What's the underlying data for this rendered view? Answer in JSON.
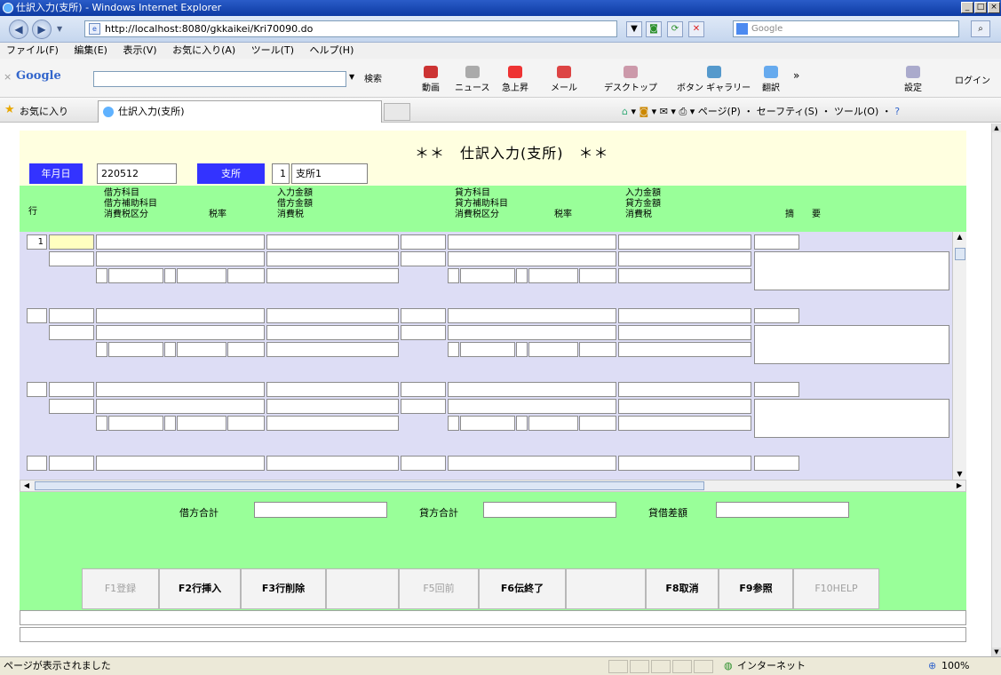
{
  "window": {
    "title": "仕訳入力(支所) - Windows Internet Explorer",
    "url": "http://localhost:8080/gkkaikei/Kri70090.do",
    "search_placeholder": "Google",
    "menu": [
      "ファイル(F)",
      "編集(E)",
      "表示(V)",
      "お気に入り(A)",
      "ツール(T)",
      "ヘルプ(H)"
    ],
    "google_label": "Google",
    "google_items": [
      "検索",
      "動画",
      "ニュース",
      "急上昇",
      "メール",
      "デスクトップ",
      "ボタン ギャラリー",
      "翻訳",
      "»",
      "設定",
      "ログイン"
    ],
    "favorites_label": "お気に入り",
    "tab_title": "仕訳入力(支所)",
    "command_bar": "ページ(P) ・ セーフティ(S) ・ ツール(O) ・",
    "status_text": "ページが表示されました",
    "zone": "インターネット",
    "zoom": "100%"
  },
  "form": {
    "title": "＊＊　仕訳入力(支所)　＊＊",
    "date_label": "年月日",
    "date_value": "220512",
    "branch_label": "支所",
    "branch_code": "1",
    "branch_name": "支所1"
  },
  "columns": {
    "row": "行",
    "debit_account": "借方科目",
    "debit_sub_account": "借方補助科目",
    "tax_category": "消費税区分",
    "tax_rate": "税率",
    "input_amount": "入力金額",
    "debit_amount": "借方金額",
    "consumption_tax": "消費税",
    "credit_account": "貸方科目",
    "credit_sub_account": "貸方補助科目",
    "tax_category2": "消費税区分",
    "tax_rate2": "税率",
    "input_amount2": "入力金額",
    "credit_amount": "貸方金額",
    "consumption_tax2": "消費税",
    "remarks": "摘　　要"
  },
  "rows": [
    {
      "no": "1"
    },
    {
      "no": ""
    },
    {
      "no": ""
    },
    {
      "no": ""
    }
  ],
  "totals": {
    "debit_total_label": "借方合計",
    "credit_total_label": "貸方合計",
    "diff_label": "貸借差額"
  },
  "function_keys": [
    {
      "label": "F1登録",
      "enabled": false
    },
    {
      "label": "F2行挿入",
      "enabled": true
    },
    {
      "label": "F3行削除",
      "enabled": true
    },
    {
      "label": "",
      "enabled": false
    },
    {
      "label": "F5回前",
      "enabled": false
    },
    {
      "label": "F6伝終了",
      "enabled": true
    },
    {
      "label": "",
      "enabled": false
    },
    {
      "label": "F8取消",
      "enabled": true
    },
    {
      "label": "F9参照",
      "enabled": true
    },
    {
      "label": "F10HELP",
      "enabled": false
    }
  ],
  "colors": {
    "header_bg": "#ffffe0",
    "grid_header_bg": "#99ff99",
    "label_bg": "#3333ff",
    "grid_bg": "#ddddf5"
  }
}
